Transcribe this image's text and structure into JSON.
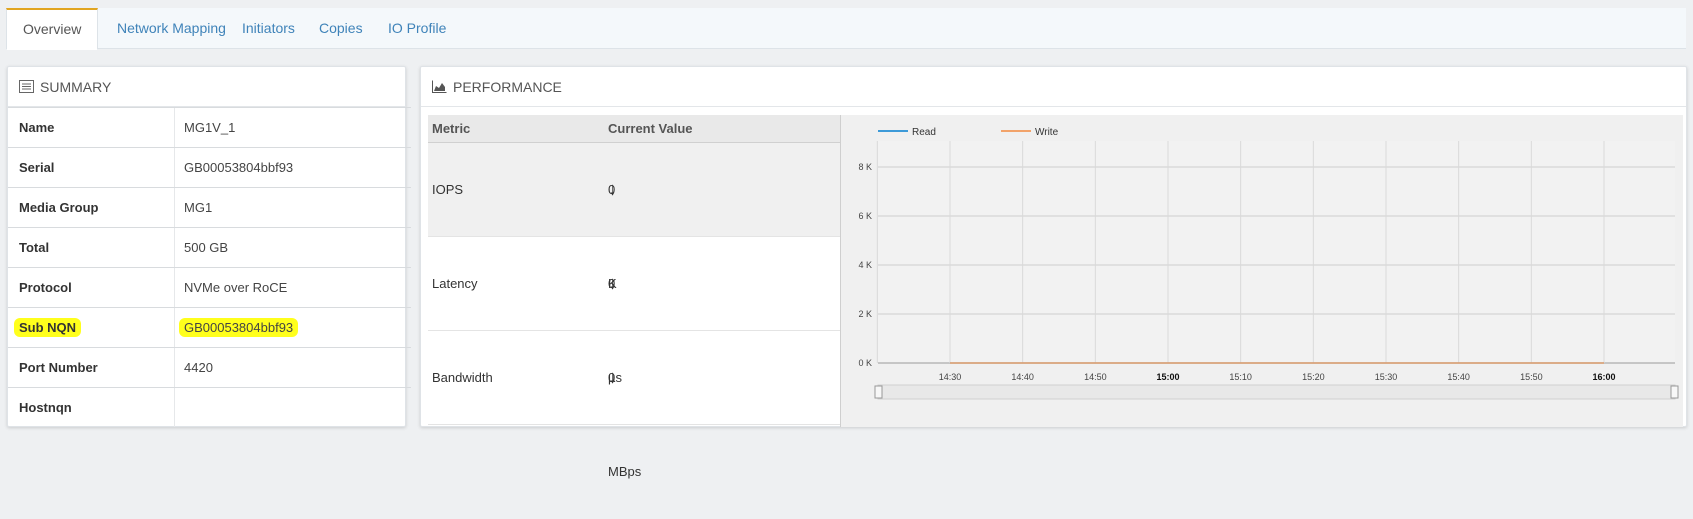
{
  "tabs": [
    {
      "label": "Overview",
      "active": true
    },
    {
      "label": "Network Mapping"
    },
    {
      "label": "Initiators"
    },
    {
      "label": "Copies"
    },
    {
      "label": "IO Profile"
    }
  ],
  "summary": {
    "title": "SUMMARY",
    "rows": [
      {
        "key": "Name",
        "value": "MG1V_1"
      },
      {
        "key": "Serial",
        "value": "GB00053804bbf93"
      },
      {
        "key": "Media Group",
        "value": "MG1"
      },
      {
        "key": "Total",
        "value": "500 GB"
      },
      {
        "key": "Protocol",
        "value": "NVMe over RoCE"
      },
      {
        "key": "Sub NQN",
        "value": "GB00053804bbf93"
      },
      {
        "key": "Port Number",
        "value": "4420"
      },
      {
        "key": "Hostnqn",
        "value": ""
      }
    ]
  },
  "performance": {
    "title": "PERFORMANCE",
    "columns": [
      "Metric",
      "Current Value"
    ],
    "metrics": [
      {
        "name": "IOPS",
        "value": "0 K"
      },
      {
        "name": "Latency",
        "value": "0 µs"
      },
      {
        "name": "Bandwidth",
        "value": "0 MBps"
      }
    ]
  },
  "chart_data": {
    "type": "line",
    "x": [
      "14:30",
      "14:40",
      "14:50",
      "15:00",
      "15:10",
      "15:20",
      "15:30",
      "15:40",
      "15:50",
      "16:00"
    ],
    "bold_ticks": [
      "15:00",
      "16:00"
    ],
    "yticks": [
      "0 K",
      "2 K",
      "4 K",
      "6 K",
      "8 K"
    ],
    "ylim": [
      0,
      8
    ],
    "grid": true,
    "legend_position": "top-left",
    "series": [
      {
        "name": "Read",
        "values": [
          0,
          0,
          0,
          0,
          0,
          0,
          0,
          0,
          0,
          0
        ],
        "color": "#3d9ad8"
      },
      {
        "name": "Write",
        "values": [
          0,
          0,
          0,
          0,
          0,
          0,
          0,
          0,
          0,
          0
        ],
        "color": "#f2a36a"
      }
    ]
  },
  "colors": {
    "accent_tab": "#e1a520",
    "link": "#3f83b9",
    "highlight": "#ffff1c"
  }
}
